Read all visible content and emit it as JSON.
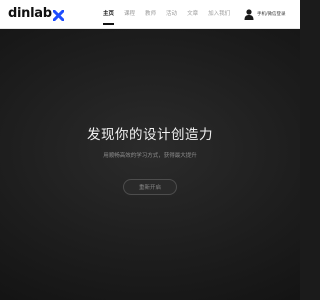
{
  "brand": {
    "logo_text": "dinlab"
  },
  "nav": {
    "items": [
      {
        "label": "主页",
        "active": true
      },
      {
        "label": "课程",
        "active": false
      },
      {
        "label": "教师",
        "active": false
      },
      {
        "label": "活动",
        "active": false
      },
      {
        "label": "文章",
        "active": false
      },
      {
        "label": "加入我们",
        "active": false
      }
    ]
  },
  "user": {
    "login_label": "手机/微信登录",
    "icon": "user-icon"
  },
  "hero": {
    "title": "发现你的设计创造力",
    "subtitle": "用顺畅高效的学习方式，获得最大提升",
    "cta_label": "重新开启"
  },
  "colors": {
    "background": "#1b1b1b",
    "header": "#ffffff",
    "accent": "#111111"
  }
}
